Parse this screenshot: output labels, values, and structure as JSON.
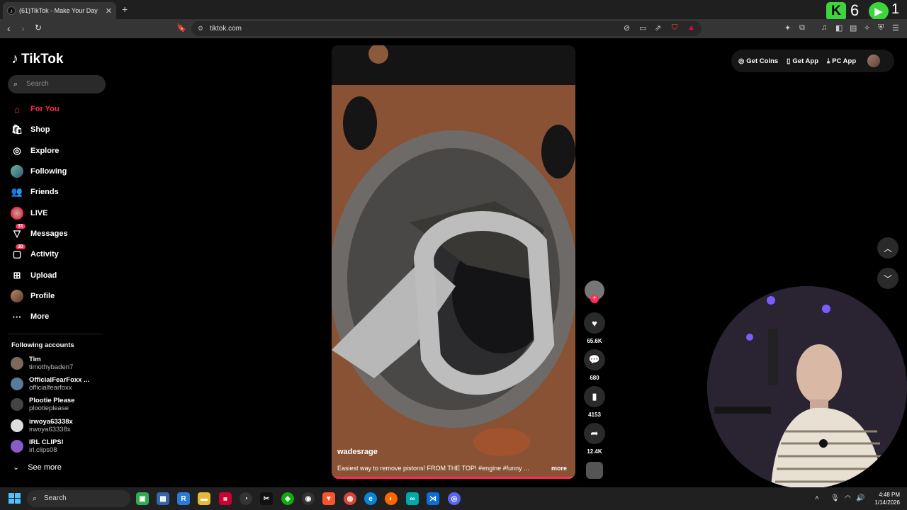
{
  "browser": {
    "tab_title": "(61)TikTok - Make Your Day",
    "new_tab": "+",
    "tab_close": "✕",
    "url": "tiktok.com",
    "extension_k_label": "K",
    "extension_k_count": "6",
    "extension_play_count": "1",
    "brave_badge": "1"
  },
  "tiktok": {
    "logo": "TikTok",
    "search_placeholder": "Search",
    "nav": [
      {
        "label": "For You",
        "icon": "home-icon"
      },
      {
        "label": "Shop",
        "icon": "shop-icon"
      },
      {
        "label": "Explore",
        "icon": "compass-icon"
      },
      {
        "label": "Following",
        "icon": "following-icon"
      },
      {
        "label": "Friends",
        "icon": "friends-icon"
      },
      {
        "label": "LIVE",
        "icon": "live-icon"
      },
      {
        "label": "Messages",
        "icon": "messages-icon",
        "badge": "31"
      },
      {
        "label": "Activity",
        "icon": "activity-icon",
        "badge": "30"
      },
      {
        "label": "Upload",
        "icon": "upload-icon"
      },
      {
        "label": "Profile",
        "icon": "profile-icon"
      },
      {
        "label": "More",
        "icon": "more-icon"
      }
    ],
    "following_title": "Following accounts",
    "following": [
      {
        "name": "Tim",
        "handle": "timothybaden7",
        "color": "#7b6a5a"
      },
      {
        "name": "OfficialFearFoxx ...",
        "handle": "officialfearfoxx",
        "color": "#5a7a9a"
      },
      {
        "name": "Plootie Please",
        "handle": "plootieplease",
        "color": "#444444"
      },
      {
        "name": "irwoya63338x",
        "handle": "irwoya63338x",
        "color": "#dddddd"
      },
      {
        "name": "IRL CLIPS!",
        "handle": "irl.clips08",
        "color": "#8a5ac8"
      }
    ],
    "see_more": "See more",
    "top_actions": {
      "get_coins": "Get Coins",
      "get_app": "Get App",
      "pc_app": "PC App"
    },
    "video": {
      "author": "wadesrage",
      "caption": "Easiest way to remove pistons! FROM THE TOP! #engine #funny ...",
      "more": "more",
      "progress": 0.98
    },
    "rail": {
      "likes": "65.6K",
      "comments": "680",
      "saves": "4153",
      "shares": "12.4K"
    }
  },
  "taskbar": {
    "search": "Search",
    "time": "4:48 PM",
    "date": "1/14/2026"
  },
  "colors": {
    "accent": "#fe2c55",
    "background": "#000000",
    "extension_green": "#3dd53d"
  }
}
